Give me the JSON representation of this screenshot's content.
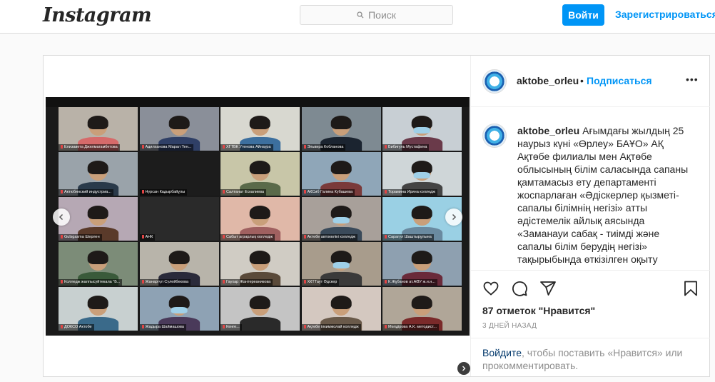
{
  "header": {
    "logo": "Instagram",
    "search_placeholder": "Поиск",
    "login_label": "Войти",
    "signup_label": "Зарегистрироваться"
  },
  "post": {
    "username": "aktobe_orleu",
    "separator": "•",
    "follow_label": "Подписаться",
    "more_label": "•••",
    "caption_username": "aktobe_orleu",
    "caption_text": "Ағымдағы жылдың 25 наурыз күні «Өрлеу» БАҰО» АҚ Ақтөбе филиалы мен Ақтөбе облысының білім саласында сапаны қамтамасыз ету департаменті жоспарлаған «Әдіскерлер қызметі-сапалы білімнің негізі» атты әдістемелік айлық аясында «Заманауи сабақ - тиімді және сапалы білім берудің негізі» тақырыбында өткізілген оқыту",
    "likes": "87 отметок \"Нравится\"",
    "date": "3 ДНЕЙ НАЗАД",
    "login_prompt_link": "Войдите",
    "login_prompt_text": ", чтобы поставить «Нравится» или прокомментировать."
  },
  "video_tiles": [
    "Елизавета Джелмагамбетова",
    "Адилханова Марал Тен...",
    "ХГТВК Утенова Айнаура",
    "Эльвира Кобланова",
    "Бибигуль Мустафина",
    "Актюбинский индустриа...",
    "Нурсан Кадырбайұлы",
    "Салтанат Ескалиева",
    "АКСиб Галина Кубашева",
    "Торамина Ирина колледж",
    "Gulsgasmа Шерлен",
    "АНК",
    "Сабыт аграрлық колледж",
    "Актөбе автокөлікі колледж",
    "Сарагүл Шаштырұлына",
    "Колледж жалпысуйтекала \"Б...",
    "Жанаргүл Сүлейбекова",
    "Гаухар Жантереаникова",
    "ХКТТаут Әдскер",
    "К.Жұбанов ат.АӨУ ж.н.н...",
    "ДОКСО Актобе",
    "Жадыра Шаймашова",
    "Кенге...",
    "Ақтөбе ілкимжолай колледж",
    "Мөлдірова А.К. методист..."
  ],
  "icons": {
    "search": "search-icon",
    "heart": "heart-icon",
    "comment": "comment-icon",
    "share": "share-icon",
    "save": "bookmark-icon",
    "prev": "chevron-left-icon",
    "next": "chevron-right-icon"
  },
  "colors": {
    "accent": "#0095f6",
    "border": "#dbdbdb",
    "muted": "#8e8e8e",
    "link_dark": "#00376b"
  }
}
